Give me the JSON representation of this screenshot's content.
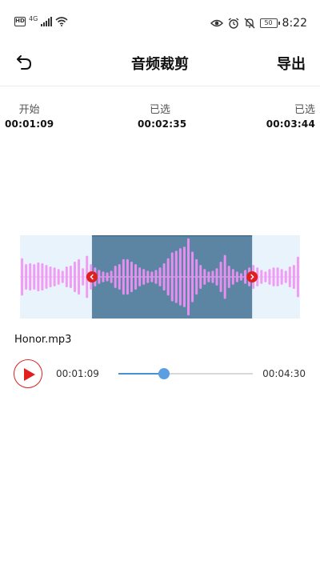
{
  "status_bar": {
    "hd": "HD",
    "network": "4G",
    "battery": "50",
    "time": "8:22"
  },
  "header": {
    "title": "音频裁剪",
    "export_label": "导出"
  },
  "times": {
    "start_label": "开始",
    "start_value": "00:01:09",
    "selected_label": "已选",
    "selected_value": "00:02:35",
    "end_label": "已选",
    "end_value": "00:03:44"
  },
  "waveform": {
    "bar_color": "#f19cf4",
    "bar_color_selected": "#e68ff0",
    "background": "#e8f3fc",
    "selection_color": "#5c84a3",
    "handle_color": "#e02020",
    "selection_start": 0.257,
    "selection_end": 0.829,
    "amplitudes": [
      0.42,
      0.28,
      0.3,
      0.28,
      0.32,
      0.3,
      0.26,
      0.22,
      0.2,
      0.16,
      0.12,
      0.22,
      0.24,
      0.34,
      0.4,
      0.18,
      0.48,
      0.28,
      0.2,
      0.14,
      0.1,
      0.08,
      0.12,
      0.24,
      0.28,
      0.4,
      0.4,
      0.34,
      0.28,
      0.2,
      0.16,
      0.12,
      0.1,
      0.14,
      0.2,
      0.3,
      0.42,
      0.56,
      0.6,
      0.66,
      0.7,
      0.9,
      0.58,
      0.4,
      0.26,
      0.16,
      0.1,
      0.12,
      0.18,
      0.34,
      0.5,
      0.24,
      0.16,
      0.1,
      0.06,
      0.14,
      0.2,
      0.26,
      0.2,
      0.14,
      0.1,
      0.16,
      0.2,
      0.2,
      0.16,
      0.12,
      0.22,
      0.26,
      0.46
    ]
  },
  "file": {
    "name": "Honor.mp3"
  },
  "player": {
    "current_time": "00:01:09",
    "total_time": "00:04:30",
    "progress": 0.34,
    "accent_color": "#4a90d9",
    "play_color": "#e02020"
  }
}
